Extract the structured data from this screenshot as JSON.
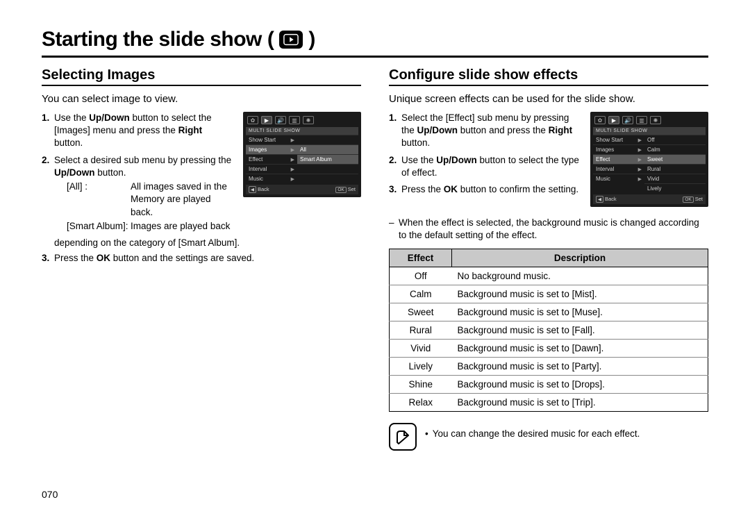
{
  "title": "Starting the slide show",
  "page_number": "070",
  "left": {
    "heading": "Selecting Images",
    "intro": "You can select image to view.",
    "step1_a": "Use the ",
    "step1_b": "Up/Down",
    "step1_c": " button to select the [Images] menu and press the ",
    "step1_d": "Right",
    "step1_e": " button.",
    "step2_a": "Select a desired sub menu by pressing the ",
    "step2_b": "Up/Down",
    "step2_c": " button.",
    "def_all_k": "[All] :",
    "def_all_v": "All images saved in the Memory are played back.",
    "def_sa_k": "[Smart Album]:",
    "def_sa_v": "Images are played back",
    "def_sa_cont": "depending on the category of [Smart Album].",
    "step3_a": "Press the ",
    "step3_b": "OK",
    "step3_c": " button and the settings are saved.",
    "lcd": {
      "title": "MULTI SLIDE SHOW",
      "rows": [
        {
          "k": "Show Start",
          "v": ""
        },
        {
          "k": "Images",
          "v": "All"
        },
        {
          "k": "Effect",
          "v": "Smart Album"
        },
        {
          "k": "Interval",
          "v": ""
        },
        {
          "k": "Music",
          "v": ""
        }
      ],
      "back": "Back",
      "set": "Set"
    }
  },
  "right": {
    "heading": "Configure slide show effects",
    "intro": "Unique screen effects can be used for the slide show.",
    "step1_a": "Select the [Effect] sub menu by pressing the ",
    "step1_b": "Up/Down",
    "step1_c": " button and press the ",
    "step1_d": "Right",
    "step1_e": " button.",
    "step2_a": "Use the ",
    "step2_b": "Up/Down",
    "step2_c": " button to select the type of effect.",
    "step3_a": "Press the ",
    "step3_b": "OK",
    "step3_c": " button to confirm the setting.",
    "note": "When the effect is selected, the background music is changed according to the default setting of the effect.",
    "table": {
      "head_effect": "Effect",
      "head_desc": "Description",
      "rows": [
        {
          "e": "Off",
          "d": "No background music."
        },
        {
          "e": "Calm",
          "d": "Background music is set to [Mist]."
        },
        {
          "e": "Sweet",
          "d": "Background music is set to [Muse]."
        },
        {
          "e": "Rural",
          "d": "Background music is set to [Fall]."
        },
        {
          "e": "Vivid",
          "d": "Background music is set to [Dawn]."
        },
        {
          "e": "Lively",
          "d": "Background music is set to [Party]."
        },
        {
          "e": "Shine",
          "d": "Background music is set to [Drops]."
        },
        {
          "e": "Relax",
          "d": "Background music is set to [Trip]."
        }
      ]
    },
    "tip": "You can change the desired music for each effect.",
    "lcd": {
      "title": "MULTI SLIDE SHOW",
      "rows": [
        {
          "k": "Show Start",
          "v": "Off"
        },
        {
          "k": "Images",
          "v": "Calm"
        },
        {
          "k": "Effect",
          "v": "Sweet"
        },
        {
          "k": "Interval",
          "v": "Rural"
        },
        {
          "k": "Music",
          "v": "Vivid"
        }
      ],
      "extra": "Lively",
      "back": "Back",
      "set": "Set"
    }
  }
}
